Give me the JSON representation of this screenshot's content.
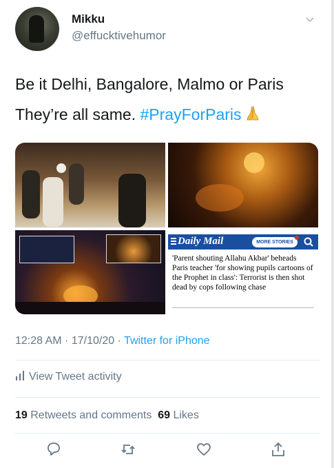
{
  "user": {
    "name": "Mikku",
    "handle": "@effucktivehumor"
  },
  "tweet": {
    "line1": "Be it Delhi, Bangalore, Malmo or Paris",
    "line2_text": "They’re all same. ",
    "hashtag": "#PrayForParis",
    "emoji": "folded-hands"
  },
  "media": {
    "article": {
      "brand": "Daily Mail",
      "more_stories": "MORE STORIES",
      "headline": "'Parent shouting Allahu Akbar' beheads Paris teacher 'for showing pupils cartoons of the Prophet in class': Terrorist is then shot dead by cops following chase"
    }
  },
  "meta": {
    "time": "12:28 AM",
    "separator": " · ",
    "date": "17/10/20",
    "source": "Twitter for iPhone"
  },
  "activity": {
    "label": "View Tweet activity"
  },
  "stats": {
    "retweets_count": "19",
    "retweets_label": "Retweets and comments",
    "likes_count": "69",
    "likes_label": "Likes"
  },
  "actions": [
    "reply-icon",
    "retweet-icon",
    "like-icon",
    "share-icon"
  ],
  "colors": {
    "accent": "#1da1f2",
    "muted": "#657786",
    "text": "#14171a",
    "dailymail": "#1a4fa0"
  }
}
